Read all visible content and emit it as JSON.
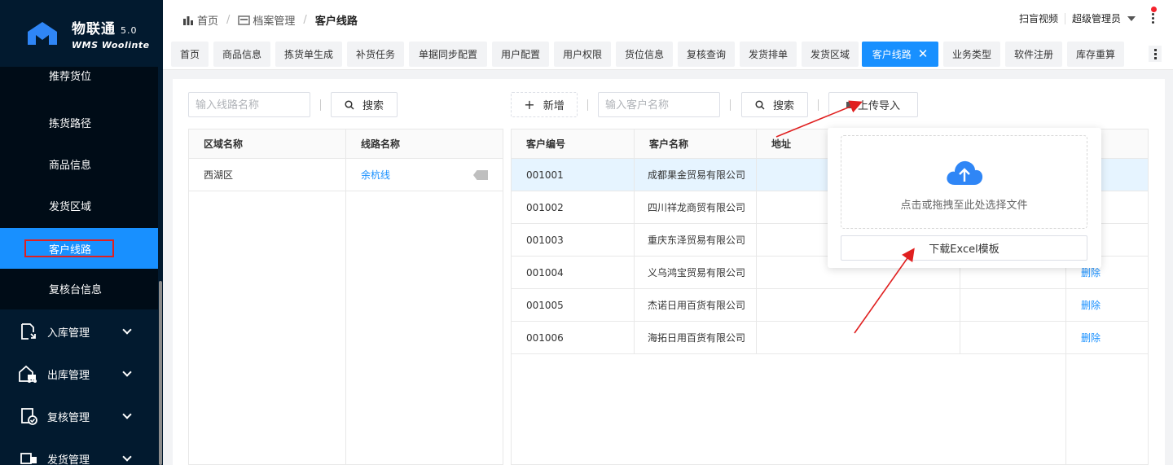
{
  "app": {
    "title": "物联通",
    "version": "5.0",
    "subtitle": "WMS Woolinte"
  },
  "sidebar": {
    "sub_items": [
      {
        "label": "推荐货位"
      },
      {
        "label": "拣货路径"
      },
      {
        "label": "商品信息"
      },
      {
        "label": "发货区域"
      },
      {
        "label": "客户线路"
      },
      {
        "label": "复核台信息"
      }
    ],
    "groups": [
      {
        "label": "入库管理",
        "icon": "inbound-icon"
      },
      {
        "label": "出库管理",
        "icon": "truck-icon"
      },
      {
        "label": "复核管理",
        "icon": "check-doc-icon"
      },
      {
        "label": "发货管理",
        "icon": "shipping-icon"
      }
    ]
  },
  "header": {
    "breadcrumbs": [
      "首页",
      "档案管理",
      "客户线路"
    ],
    "video_link": "扫盲视频",
    "user": "超级管理员"
  },
  "tabs": [
    "首页",
    "商品信息",
    "拣货单生成",
    "补货任务",
    "单据同步配置",
    "用户配置",
    "用户权限",
    "货位信息",
    "复核查询",
    "发货排单",
    "发货区域",
    "客户线路",
    "业务类型",
    "软件注册",
    "库存重算"
  ],
  "active_tab": "客户线路",
  "left_panel": {
    "search_placeholder": "输入线路名称",
    "search_label": "搜索",
    "columns": [
      "区域名称",
      "线路名称"
    ],
    "rows": [
      {
        "area": "西湖区",
        "route": "余杭线"
      }
    ]
  },
  "right_panel": {
    "add_label": "新增",
    "search_placeholder": "输入客户名称",
    "search_label": "搜索",
    "upload_label": "上传导入",
    "columns": [
      "客户编号",
      "客户名称",
      "地址"
    ],
    "rows": [
      {
        "code": "001001",
        "name": "成都果金贸易有限公司",
        "address": ""
      },
      {
        "code": "001002",
        "name": "四川祥龙商贸有限公司",
        "address": ""
      },
      {
        "code": "001003",
        "name": "重庆东泽贸易有限公司",
        "address": ""
      },
      {
        "code": "001004",
        "name": "义乌鸿宝贸易有限公司",
        "address": "",
        "action": "删除"
      },
      {
        "code": "001005",
        "name": "杰诺日用百货有限公司",
        "address": "",
        "action": "删除"
      },
      {
        "code": "001006",
        "name": "海拓日用百货有限公司",
        "address": "",
        "action": "删除"
      }
    ]
  },
  "upload_popover": {
    "drop_text": "点击或拖拽至此处选择文件",
    "download_label": "下载Excel模板"
  },
  "colors": {
    "sidebar_bg": "#021a2f",
    "submenu_bg": "#000c17",
    "accent": "#1890ff",
    "annotation": "#e02020"
  }
}
